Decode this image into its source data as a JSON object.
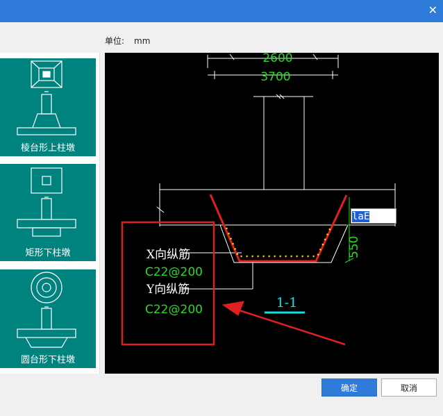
{
  "window": {
    "close_glyph": "✕"
  },
  "unit": {
    "label": "单位:",
    "value": "mm"
  },
  "types": [
    {
      "label": "棱台形上柱墩"
    },
    {
      "label": "矩形下柱墩"
    },
    {
      "label": "圆台形下柱墩"
    }
  ],
  "drawing": {
    "dim_top": "2600",
    "dim_width": "3700",
    "dim_height": "550",
    "x_bar_label": "X向纵筋",
    "x_bar_value": "C22@200",
    "y_bar_label": "Y向纵筋",
    "y_bar_value": "C22@200",
    "section": "1-1",
    "input_value": "laE"
  },
  "buttons": {
    "ok": "确定",
    "cancel": "取消"
  },
  "colors": {
    "card": "#00827f",
    "titlebar": "#2f7bd9",
    "dim_green": "#22dd22",
    "highlight_red": "#e02020",
    "section_cyan": "#00e5e5"
  }
}
